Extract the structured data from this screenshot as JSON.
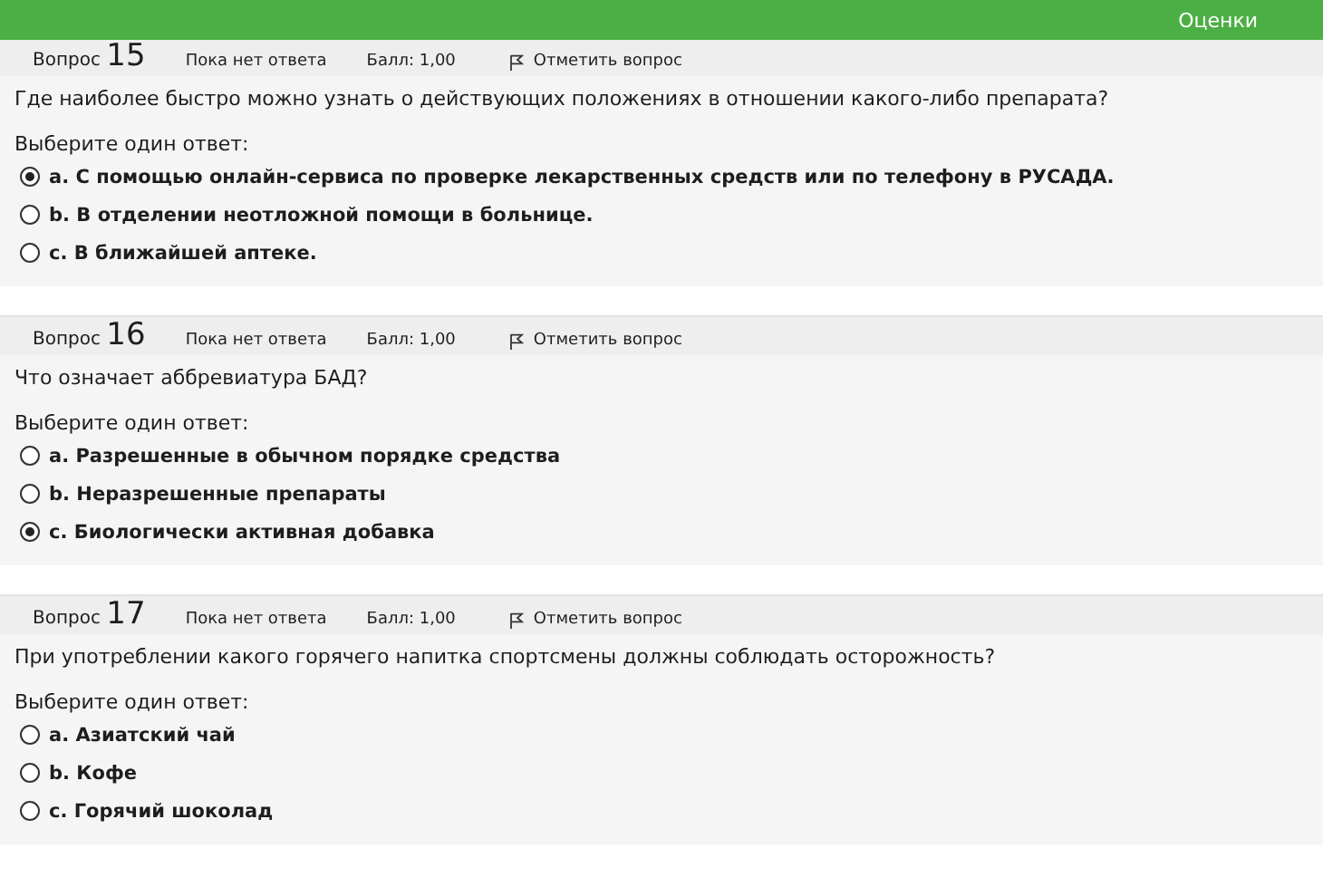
{
  "topbar": {
    "link": "Оценки"
  },
  "questions": [
    {
      "label": "Вопрос",
      "number": "15",
      "status": "Пока нет ответа",
      "score": "Балл: 1,00",
      "flag": "Отметить вопрос",
      "text": "Где наиболее быстро можно узнать о действующих положениях в отношении какого-либо препарата?",
      "prompt": "Выберите один ответ:",
      "options": [
        {
          "text": "a. С помощью онлайн-сервиса по проверке лекарственных средств или по телефону в РУСАДА.",
          "selected": true
        },
        {
          "text": "b. В отделении неотложной помощи в больнице.",
          "selected": false
        },
        {
          "text": "c. В ближайшей аптеке.",
          "selected": false
        }
      ]
    },
    {
      "label": "Вопрос",
      "number": "16",
      "status": "Пока нет ответа",
      "score": "Балл: 1,00",
      "flag": "Отметить вопрос",
      "text": "Что означает аббревиатура БАД?",
      "prompt": "Выберите один ответ:",
      "options": [
        {
          "text": "a. Разрешенные в обычном порядке средства",
          "selected": false
        },
        {
          "text": "b. Неразрешенные препараты",
          "selected": false
        },
        {
          "text": "c. Биологически активная добавка",
          "selected": true
        }
      ]
    },
    {
      "label": "Вопрос",
      "number": "17",
      "status": "Пока нет ответа",
      "score": "Балл: 1,00",
      "flag": "Отметить вопрос",
      "text": "При употреблении какого горячего напитка спортсмены должны соблюдать осторожность?",
      "prompt": "Выберите один ответ:",
      "options": [
        {
          "text": "a. Азиатский чай",
          "selected": false
        },
        {
          "text": "b. Кофе",
          "selected": false
        },
        {
          "text": "c. Горячий шоколад",
          "selected": false
        }
      ]
    }
  ]
}
